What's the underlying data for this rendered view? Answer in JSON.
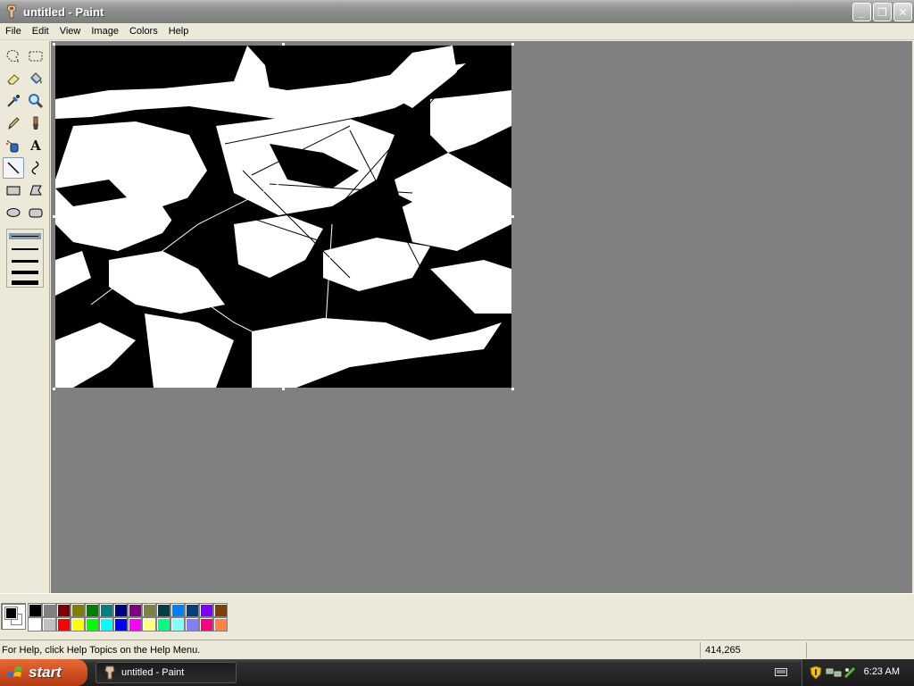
{
  "window": {
    "title": "untitled - Paint",
    "buttons": {
      "minimize": "_",
      "maximize": "❐",
      "close": "✕"
    }
  },
  "menu": {
    "items": [
      "File",
      "Edit",
      "View",
      "Image",
      "Colors",
      "Help"
    ]
  },
  "toolbox": {
    "tools": [
      {
        "name": "free-form-select-icon"
      },
      {
        "name": "select-icon"
      },
      {
        "name": "eraser-icon"
      },
      {
        "name": "fill-with-color-icon"
      },
      {
        "name": "pick-color-icon"
      },
      {
        "name": "magnifier-icon"
      },
      {
        "name": "pencil-icon"
      },
      {
        "name": "brush-icon"
      },
      {
        "name": "airbrush-icon"
      },
      {
        "name": "text-icon"
      },
      {
        "name": "line-icon",
        "active": true
      },
      {
        "name": "curve-icon"
      },
      {
        "name": "rectangle-icon"
      },
      {
        "name": "polygon-icon"
      },
      {
        "name": "ellipse-icon"
      },
      {
        "name": "rounded-rectangle-icon"
      }
    ],
    "text_tool_glyph": "A"
  },
  "palette": {
    "foreground": "#000000",
    "background": "#ffffff",
    "colors": [
      "#000000",
      "#808080",
      "#800000",
      "#808000",
      "#008000",
      "#008080",
      "#000080",
      "#800080",
      "#808040",
      "#004040",
      "#0080ff",
      "#004080",
      "#8000ff",
      "#804000",
      "#ffffff",
      "#c0c0c0",
      "#ff0000",
      "#ffff00",
      "#00ff00",
      "#00ffff",
      "#0000ff",
      "#ff00ff",
      "#ffff80",
      "#00ff80",
      "#80ffff",
      "#8080ff",
      "#ff0080",
      "#ff8040"
    ]
  },
  "statusbar": {
    "help": "For Help, click Help Topics on the Help Menu.",
    "coords": "414,265"
  },
  "taskbar": {
    "start": "start",
    "task": "untitled - Paint",
    "clock": "6:23 AM"
  }
}
